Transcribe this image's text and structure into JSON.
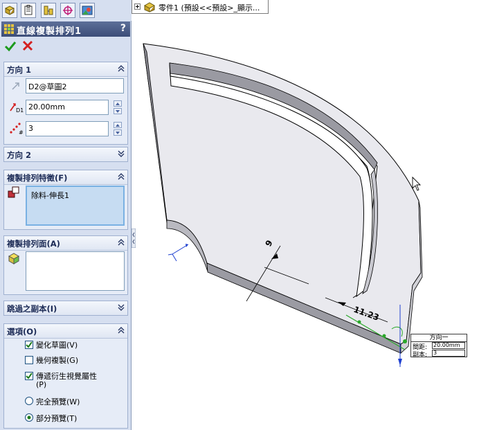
{
  "tree": {
    "part_label": "零件1 (預設<<預設>_顯示..."
  },
  "pm": {
    "title": "直線複製排列1",
    "help": "?",
    "direction1": {
      "title": "方向 1",
      "direction_value": "D2@草圖2",
      "spacing_value": "20.00mm",
      "instances_value": "3",
      "spacing_icon_label": "D1"
    },
    "direction2": {
      "title": "方向 2"
    },
    "features": {
      "title": "複製排列特徵(F)",
      "items": [
        "除料-伸長1"
      ]
    },
    "faces": {
      "title": "複製排列面(A)"
    },
    "skip": {
      "title": "跳過之副本(I)"
    },
    "options": {
      "title": "選項(O)",
      "vary_sketch": "變化草圖(V)",
      "geometry_pattern": "幾何複製(G)",
      "propagate_line1": "傳遞衍生視覺屬性",
      "propagate_line2": "(P)",
      "full_preview": "完全預覽(W)",
      "partial_preview": "部分預覽(T)",
      "vary_sketch_checked": true,
      "geometry_pattern_checked": false,
      "propagate_checked": true,
      "preview_mode": "partial"
    }
  },
  "viewport": {
    "dim_label": "11.23",
    "callout": {
      "title": "方向一",
      "spacing_label": "間距:",
      "spacing_value": "20.00mm",
      "copies_label": "副本:",
      "copies_value": "3"
    }
  },
  "colors": {
    "title_bar": "#3c4d78",
    "panel_bg": "#d6dff0",
    "ok_green": "#1c9a1c",
    "cancel_red": "#d42020",
    "selection_blue": "#c6dcf2",
    "part_face": "#e8e8ec",
    "part_edge": "#000000"
  }
}
